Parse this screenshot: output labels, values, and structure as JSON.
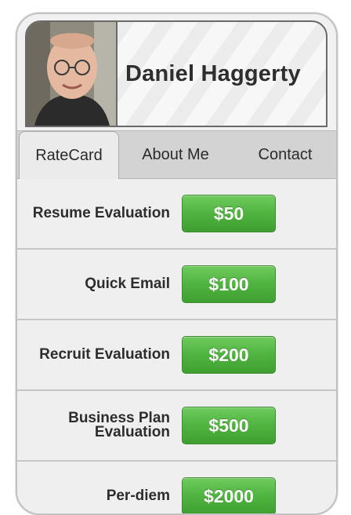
{
  "profile": {
    "name": "Daniel Haggerty"
  },
  "tabs": [
    {
      "label": "RateCard",
      "active": true
    },
    {
      "label": "About Me",
      "active": false
    },
    {
      "label": "Contact",
      "active": false
    }
  ],
  "ratecard": [
    {
      "service": "Resume Evaluation",
      "price": "$50"
    },
    {
      "service": "Quick Email",
      "price": "$100"
    },
    {
      "service": "Recruit Evaluation",
      "price": "$200"
    },
    {
      "service": "Business Plan Evaluation",
      "price": "$500"
    },
    {
      "service": "Per-diem",
      "price": "$2000"
    }
  ],
  "colors": {
    "accent": "#4fb43f",
    "frame": "#c2c2c2"
  }
}
